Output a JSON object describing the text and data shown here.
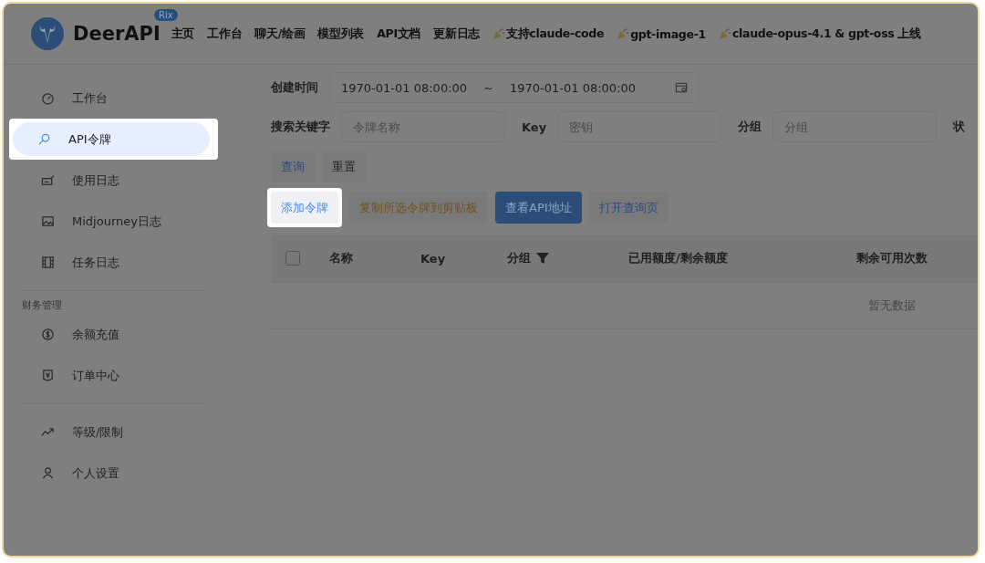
{
  "header": {
    "brand": "DeerAPI",
    "badge": "Rix",
    "nav": [
      {
        "label": "主页",
        "party": false
      },
      {
        "label": "工作台",
        "party": false
      },
      {
        "label": "聊天/绘画",
        "party": false
      },
      {
        "label": "模型列表",
        "party": false
      },
      {
        "label": "API文档",
        "party": false
      },
      {
        "label": "更新日志",
        "party": false
      },
      {
        "label": "支持claude-code",
        "party": true
      },
      {
        "label": "gpt-image-1",
        "party": true
      },
      {
        "label": "claude-opus-4.1 & gpt-oss 上线",
        "party": true
      }
    ]
  },
  "sidebar": {
    "groups": [
      {
        "items": [
          {
            "label": "工作台",
            "selected": false
          },
          {
            "label": "API令牌",
            "selected": true
          },
          {
            "label": "使用日志",
            "selected": false
          },
          {
            "label": "Midjourney日志",
            "selected": false
          },
          {
            "label": "任务日志",
            "selected": false
          }
        ]
      },
      {
        "title": "财务管理",
        "items": [
          {
            "label": "余额充值",
            "selected": false
          },
          {
            "label": "订单中心",
            "selected": false
          }
        ]
      },
      {
        "items": [
          {
            "label": "等级/限制",
            "selected": false
          },
          {
            "label": "个人设置",
            "selected": false
          }
        ]
      }
    ]
  },
  "filters": {
    "time_label": "创建时间",
    "start": "1970-01-01 08:00:00",
    "separator": "~",
    "end": "1970-01-01 08:00:00",
    "keyword_label": "搜索关键字",
    "keyword_placeholder": "令牌名称",
    "key_label": "Key",
    "key_placeholder": "密钥",
    "group_label": "分组",
    "group_placeholder": "分组",
    "status_label": "状"
  },
  "query_buttons": [
    {
      "label": "查询",
      "kind": "link"
    },
    {
      "label": "重置",
      "kind": "plain"
    }
  ],
  "actions": [
    {
      "label": "添加令牌",
      "kind": "link",
      "highlighted": true
    },
    {
      "label": "复制所选令牌到剪贴板",
      "kind": "warning",
      "highlighted": false
    },
    {
      "label": "查看API地址",
      "kind": "primary",
      "highlighted": false
    },
    {
      "label": "打开查询页",
      "kind": "link",
      "highlighted": false
    }
  ],
  "table": {
    "select_all": {
      "checked": false
    },
    "columns": [
      {
        "label": "名称",
        "filter": false
      },
      {
        "label": "Key",
        "filter": false
      },
      {
        "label": "分组",
        "filter": true
      },
      {
        "label": "已用额度/剩余额度",
        "filter": false
      },
      {
        "label": "剩余可用次数",
        "filter": false
      }
    ],
    "empty": "暂无数据"
  }
}
